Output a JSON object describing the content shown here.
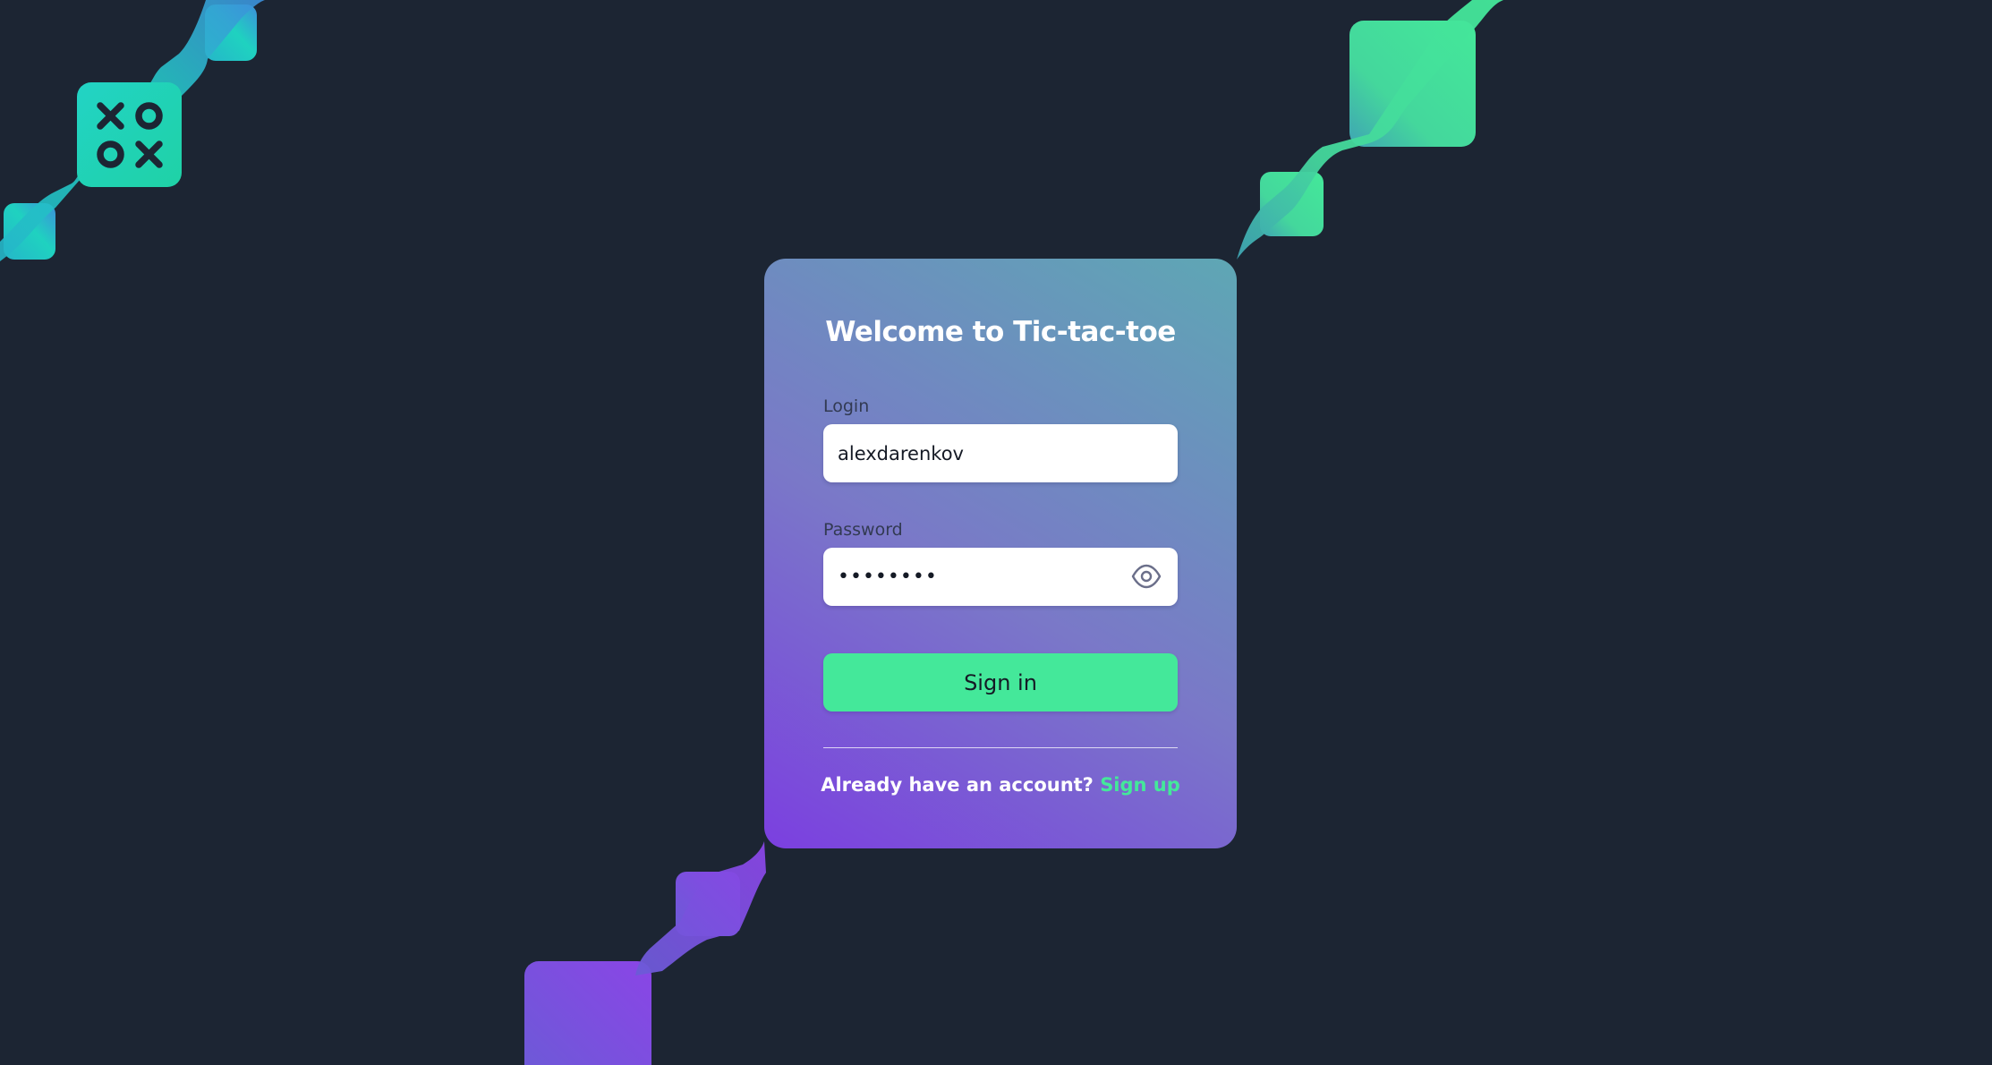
{
  "app": {
    "logo_icon": "tic-tac-toe-logo-icon"
  },
  "card": {
    "title": "Welcome to Tic-tac-toe",
    "login": {
      "label": "Login",
      "value": "alexdarenkov"
    },
    "password": {
      "label": "Password",
      "value": "••••••••",
      "toggle_icon": "eye-icon"
    },
    "signin_label": "Sign in",
    "footer_text": "Already have an account?",
    "signup_link": "Sign up"
  },
  "colors": {
    "background": "#1c2533",
    "accent_green": "#44e89a",
    "accent_purple": "#7b3fe0",
    "accent_teal": "#22d3c5",
    "input_bg": "#ffffff"
  }
}
